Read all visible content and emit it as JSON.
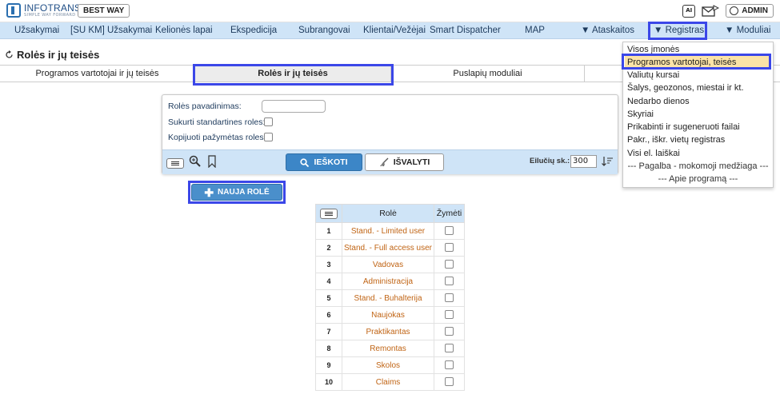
{
  "header": {
    "logo_text": "INFOTRANS",
    "logo_tagline": "SIMPLE WAY FORWARD",
    "company_button": "BEST WAY",
    "ai_icon_label": "AI",
    "user_label": "ADMIN"
  },
  "menu": {
    "items": [
      "Užsakymai",
      "[SU KM] Užsakymai",
      "Kelionės lapai",
      "Ekspedicija",
      "Subrangovai",
      "Klientai/Vežėjai",
      "Smart Dispatcher",
      "MAP",
      "▼ Ataskaitos",
      "▼ Registras",
      "▼ Moduliai"
    ]
  },
  "page": {
    "title": "Rolės ir jų teisės",
    "tabs": [
      "Programos vartotojai ir jų teisės",
      "Rolės ir jų teisės",
      "Puslapių moduliai"
    ],
    "active_tab_index": 1
  },
  "search": {
    "role_name_label": "Rolės pavadinimas:",
    "role_name_value": "",
    "create_standard_label": "Sukurti standartines roles:",
    "copy_marked_label": "Kopijuoti pažymėtas roles:",
    "search_button": "IEŠKOTI",
    "clear_button": "IŠVALYTI",
    "rows_label": "Eilučių sk.:",
    "rows_value": "300"
  },
  "new_role_button": "NAUJA ROLĖ",
  "roles_table": {
    "headers": [
      "Rolė",
      "Žymėti"
    ],
    "rows": [
      {
        "num": "1",
        "name": "Stand. - Limited user"
      },
      {
        "num": "2",
        "name": "Stand. - Full access user"
      },
      {
        "num": "3",
        "name": "Vadovas"
      },
      {
        "num": "4",
        "name": "Administracija"
      },
      {
        "num": "5",
        "name": "Stand. - Buhalterija"
      },
      {
        "num": "6",
        "name": "Naujokas"
      },
      {
        "num": "7",
        "name": "Praktikantas"
      },
      {
        "num": "8",
        "name": "Remontas"
      },
      {
        "num": "9",
        "name": "Skolos"
      },
      {
        "num": "10",
        "name": "Claims"
      }
    ]
  },
  "registras_dropdown": {
    "items": [
      "Visos įmonės",
      "Programos vartotojai, teisės",
      "Valiutų kursai",
      "Šalys, geozonos, miestai ir kt.",
      "Nedarbo dienos",
      "Skyriai",
      "Prikabinti ir sugeneruoti failai",
      "Pakr., iškr. vietų registras",
      "Visi el. laiškai",
      "--- Pagalba - mokomoji medžiaga ---",
      "--- Apie programą ---"
    ],
    "selected_index": 1
  },
  "colors": {
    "menubar": "#cfe4f7",
    "highlight": "#3b47e8",
    "primary_button": "#3c86c7",
    "role_link": "#c06414",
    "selected_item": "#fbe3a7"
  }
}
